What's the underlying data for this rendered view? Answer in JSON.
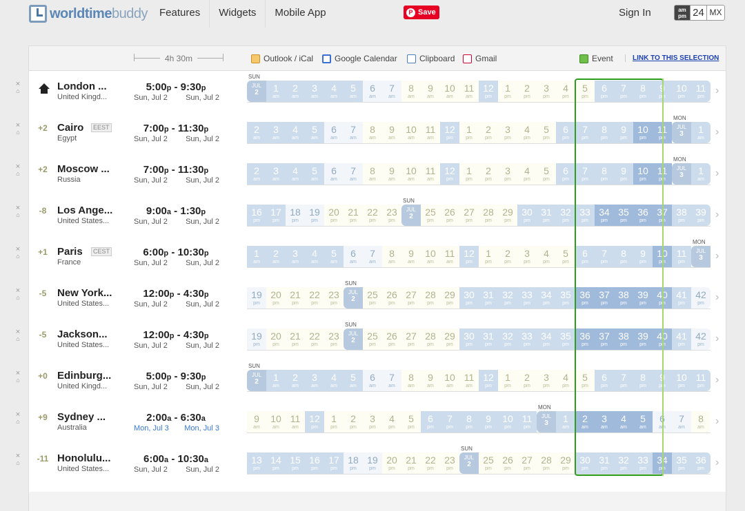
{
  "header": {
    "logo_bold": "worldtime",
    "logo_light": "buddy",
    "nav": [
      "Features",
      "Widgets",
      "Mobile App"
    ],
    "save_label": "Save",
    "signin": "Sign In",
    "fmt_ampm_1": "am",
    "fmt_ampm_2": "pm",
    "fmt_24": "24",
    "fmt_mx": "MX"
  },
  "toolbar": {
    "duration": "4h 30m",
    "outlook": "Outlook / iCal",
    "gcal": "Google Calendar",
    "clipboard": "Clipboard",
    "gmail": "Gmail",
    "event": "Event",
    "link": "LINK TO THIS SELECTION"
  },
  "colors": {
    "selection": "#2d9d1e",
    "pinterest": "#e60023",
    "link": "#1a3fb0",
    "blue_date": "#3a79d8"
  },
  "rows": [
    {
      "offset": "",
      "home": true,
      "city": "London ...",
      "abbr": "",
      "country": "United Kingd...",
      "time_from": "5:00",
      "from_ap": "p",
      "time_to": "9:30",
      "to_ap": "p",
      "date_from": "Sun, Jul 2",
      "date_to": "Sun, Jul 2",
      "blue": false,
      "day_label": "SUN",
      "day_cell": 0,
      "date_month": "JUL",
      "date_day": "2",
      "start": 0,
      "start_ap": "am",
      "sel_start": 17
    },
    {
      "offset": "+2",
      "home": false,
      "city": "Cairo",
      "abbr": "EEST",
      "country": "Egypt",
      "time_from": "7:00",
      "from_ap": "p",
      "time_to": "11:30",
      "to_ap": "p",
      "date_from": "Sun, Jul 2",
      "date_to": "Sun, Jul 2",
      "blue": false,
      "day_label": "MON",
      "day_cell": 22,
      "date_month": "JUL",
      "date_day": "3",
      "start": 2,
      "start_ap": "am",
      "sel_start": 17
    },
    {
      "offset": "+2",
      "home": false,
      "city": "Moscow ...",
      "abbr": "",
      "country": "Russia",
      "time_from": "7:00",
      "from_ap": "p",
      "time_to": "11:30",
      "to_ap": "p",
      "date_from": "Sun, Jul 2",
      "date_to": "Sun, Jul 2",
      "blue": false,
      "day_label": "MON",
      "day_cell": 22,
      "date_month": "JUL",
      "date_day": "3",
      "start": 2,
      "start_ap": "am",
      "sel_start": 17
    },
    {
      "offset": "-8",
      "home": false,
      "city": "Los Ange...",
      "abbr": "",
      "country": "United States...",
      "time_from": "9:00",
      "from_ap": "a",
      "time_to": "1:30",
      "to_ap": "p",
      "date_from": "Sun, Jul 2",
      "date_to": "Sun, Jul 2",
      "blue": false,
      "day_label": "SUN",
      "day_cell": 8,
      "date_month": "JUL",
      "date_day": "2",
      "start": 16,
      "start_ap": "pm",
      "sel_start": 17
    },
    {
      "offset": "+1",
      "home": false,
      "city": "Paris",
      "abbr": "CEST",
      "country": "France",
      "time_from": "6:00",
      "from_ap": "p",
      "time_to": "10:30",
      "to_ap": "p",
      "date_from": "Sun, Jul 2",
      "date_to": "Sun, Jul 2",
      "blue": false,
      "day_label": "MON",
      "day_cell": 23,
      "date_month": "JUL",
      "date_day": "3",
      "start": 1,
      "start_ap": "am",
      "sel_start": 17
    },
    {
      "offset": "-5",
      "home": false,
      "city": "New York...",
      "abbr": "",
      "country": "United States...",
      "time_from": "12:00",
      "from_ap": "p",
      "time_to": "4:30",
      "to_ap": "p",
      "date_from": "Sun, Jul 2",
      "date_to": "Sun, Jul 2",
      "blue": false,
      "day_label": "SUN",
      "day_cell": 5,
      "date_month": "JUL",
      "date_day": "2",
      "start": 19,
      "start_ap": "pm",
      "sel_start": 17
    },
    {
      "offset": "-5",
      "home": false,
      "city": "Jackson...",
      "abbr": "",
      "country": "United States...",
      "time_from": "12:00",
      "from_ap": "p",
      "time_to": "4:30",
      "to_ap": "p",
      "date_from": "Sun, Jul 2",
      "date_to": "Sun, Jul 2",
      "blue": false,
      "day_label": "SUN",
      "day_cell": 5,
      "date_month": "JUL",
      "date_day": "2",
      "start": 19,
      "start_ap": "pm",
      "sel_start": 17
    },
    {
      "offset": "+0",
      "home": false,
      "city": "Edinburg...",
      "abbr": "",
      "country": "United Kingd...",
      "time_from": "5:00",
      "from_ap": "p",
      "time_to": "9:30",
      "to_ap": "p",
      "date_from": "Sun, Jul 2",
      "date_to": "Sun, Jul 2",
      "blue": false,
      "day_label": "SUN",
      "day_cell": 0,
      "date_month": "JUL",
      "date_day": "2",
      "start": 0,
      "start_ap": "am",
      "sel_start": 17
    },
    {
      "offset": "+9",
      "home": false,
      "city": "Sydney ...",
      "abbr": "",
      "country": "Australia",
      "time_from": "2:00",
      "from_ap": "a",
      "time_to": "6:30",
      "to_ap": "a",
      "date_from": "Mon, Jul 3",
      "date_to": "Mon, Jul 3",
      "blue": true,
      "day_label": "MON",
      "day_cell": 15,
      "date_month": "JUL",
      "date_day": "3",
      "start": 9,
      "start_ap": "am",
      "sel_start": 17
    },
    {
      "offset": "-11",
      "home": false,
      "city": "Honolulu...",
      "abbr": "",
      "country": "United States...",
      "time_from": "6:00",
      "from_ap": "a",
      "time_to": "10:30",
      "to_ap": "a",
      "date_from": "Sun, Jul 2",
      "date_to": "Sun, Jul 2",
      "blue": false,
      "day_label": "SUN",
      "day_cell": 11,
      "date_month": "JUL",
      "date_day": "2",
      "start": 13,
      "start_ap": "pm",
      "sel_start": 17
    }
  ]
}
